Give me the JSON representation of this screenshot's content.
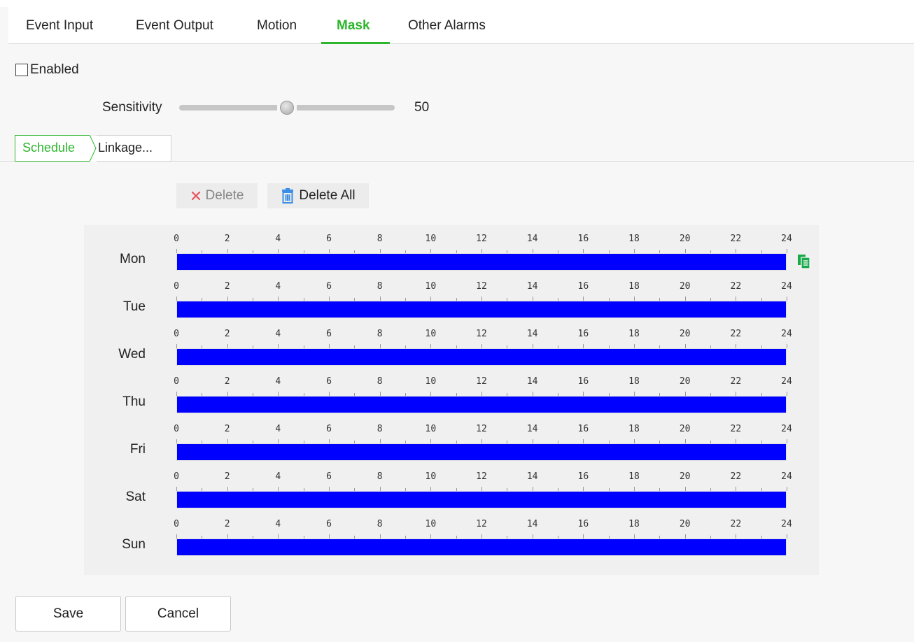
{
  "tabs": [
    {
      "label": "Event Input"
    },
    {
      "label": "Event Output"
    },
    {
      "label": "Motion"
    },
    {
      "label": "Mask"
    },
    {
      "label": "Other Alarms"
    }
  ],
  "active_tab": "Mask",
  "enabled": {
    "label": "Enabled",
    "checked": false
  },
  "sensitivity": {
    "label": "Sensitivity",
    "value": "50",
    "level": 50,
    "min": 0,
    "max": 100
  },
  "subtabs": {
    "schedule": "Schedule",
    "linkage": "Linkage..."
  },
  "actions": {
    "delete_label": "Delete",
    "delete_all_label": "Delete All"
  },
  "schedule": {
    "ticks": [
      "0",
      "2",
      "4",
      "6",
      "8",
      "10",
      "12",
      "14",
      "16",
      "18",
      "20",
      "22",
      "24"
    ],
    "days": [
      {
        "label": "Mon",
        "segments": [
          [
            0,
            24
          ]
        ]
      },
      {
        "label": "Tue",
        "segments": [
          [
            0,
            24
          ]
        ]
      },
      {
        "label": "Wed",
        "segments": [
          [
            0,
            24
          ]
        ]
      },
      {
        "label": "Thu",
        "segments": [
          [
            0,
            24
          ]
        ]
      },
      {
        "label": "Fri",
        "segments": [
          [
            0,
            24
          ]
        ]
      },
      {
        "label": "Sat",
        "segments": [
          [
            0,
            24
          ]
        ]
      },
      {
        "label": "Sun",
        "segments": [
          [
            0,
            24
          ]
        ]
      }
    ],
    "fill_color": "#0000ff",
    "copy_icon": "copy-icon"
  },
  "footer": {
    "save_label": "Save",
    "cancel_label": "Cancel"
  },
  "colors": {
    "accent": "#2db52d",
    "delete_x": "#e8505b",
    "trash": "#3a8ee6",
    "copy": "#19a84a"
  }
}
